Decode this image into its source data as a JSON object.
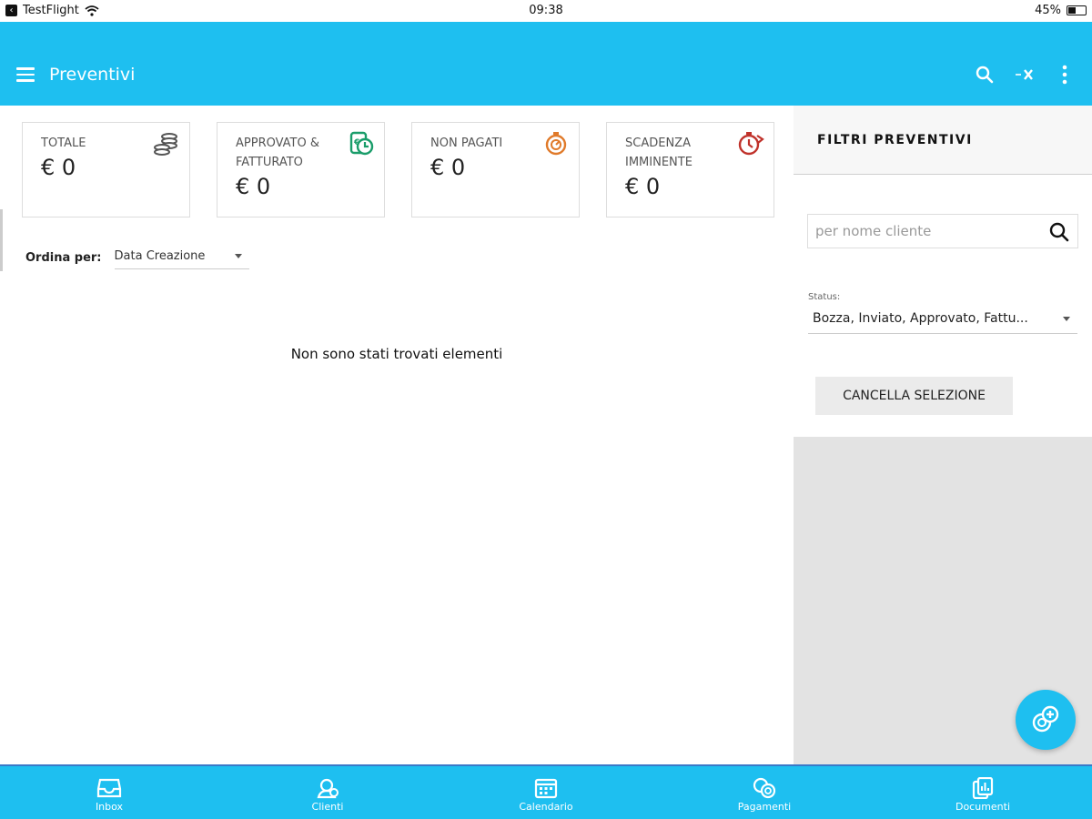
{
  "status_bar": {
    "app": "TestFlight",
    "time": "09:38",
    "battery": "45%",
    "battery_level": 0.45
  },
  "appbar": {
    "title": "Preventivi"
  },
  "cards": [
    {
      "label": "TOTALE",
      "value": "€ 0",
      "icon": "coins-icon",
      "color": "#555555"
    },
    {
      "label": "APPROVATO & FATTURATO",
      "value": "€ 0",
      "icon": "approved-invoice-icon",
      "color": "#1a9d6a"
    },
    {
      "label": "NON PAGATI",
      "value": "€ 0",
      "icon": "stopwatch-icon",
      "color": "#e07a2a"
    },
    {
      "label": "SCADENZA IMMINENTE",
      "value": "€ 0",
      "icon": "timer-arrow-icon",
      "color": "#c0322b"
    }
  ],
  "sort": {
    "label": "Ordina per:",
    "selected": "Data Creazione"
  },
  "empty_message": "Non sono stati trovati elementi",
  "filters": {
    "title": "FILTRI PREVENTIVI",
    "search_placeholder": "per nome cliente",
    "status_label": "Status:",
    "status_value": "Bozza, Inviato, Approvato, Fattu...",
    "clear_button": "CANCELLA SELEZIONE"
  },
  "bottom_nav": [
    {
      "label": "Inbox",
      "icon": "inbox-icon"
    },
    {
      "label": "Clienti",
      "icon": "clients-icon"
    },
    {
      "label": "Calendario",
      "icon": "calendar-icon"
    },
    {
      "label": "Pagamenti",
      "icon": "payments-icon"
    },
    {
      "label": "Documenti",
      "icon": "documents-icon"
    }
  ],
  "colors": {
    "primary": "#1ebff0",
    "panel_gray": "#e3e3e3"
  }
}
